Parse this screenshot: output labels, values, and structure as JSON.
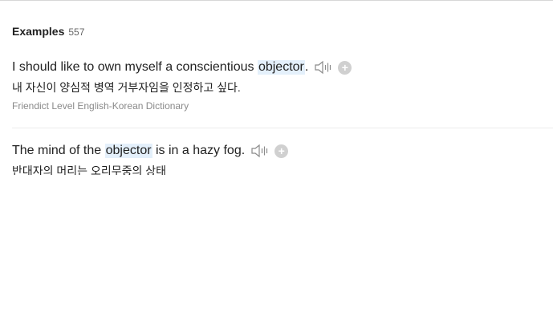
{
  "header": {
    "title": "Examples",
    "count": "557"
  },
  "examples": [
    {
      "before": "I should like to own myself a conscientious ",
      "keyword": "objector",
      "after": ".",
      "translation": "내 자신이 양심적 병역 거부자임을 인정하고 싶다.",
      "source": "Friendict Level English-Korean Dictionary"
    },
    {
      "before": "The mind of the ",
      "keyword": "objector",
      "after": " is in a hazy fog.",
      "translation": "반대자의 머리는 오리무중의 상태"
    }
  ],
  "icons": {
    "speaker": "speaker-icon",
    "add": "plus-circle-icon"
  },
  "colors": {
    "highlight": "#e4f0fb",
    "add_button": "#d0d0d0"
  }
}
